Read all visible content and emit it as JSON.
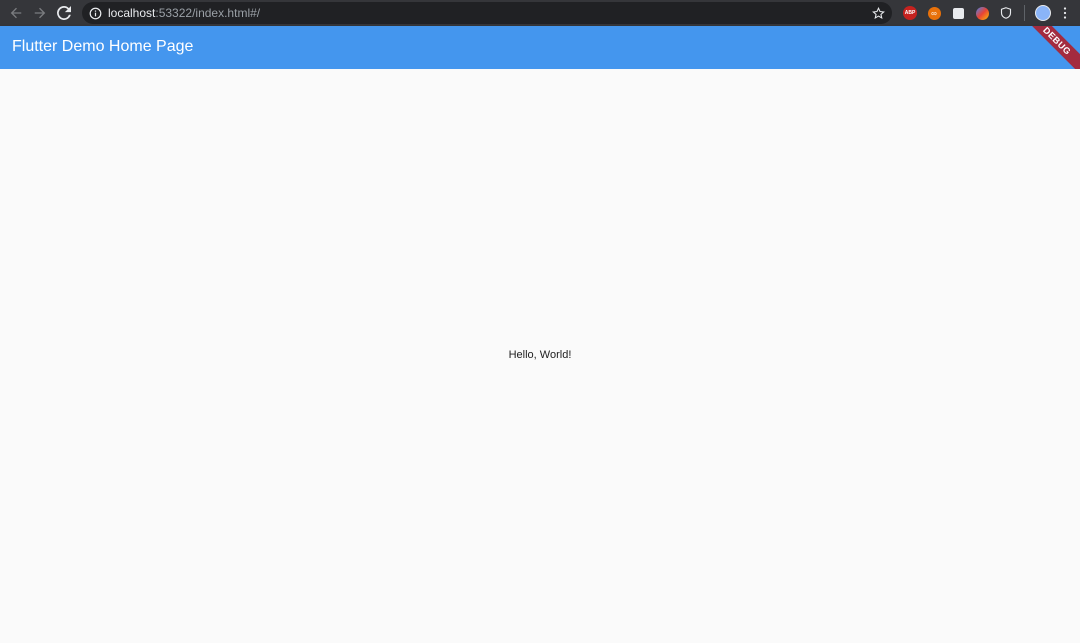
{
  "browser": {
    "url_host": "localhost",
    "url_rest": ":53322/index.html#/",
    "icons": {
      "back": "back-arrow-icon",
      "forward": "forward-arrow-icon",
      "reload": "reload-icon",
      "info": "info-icon",
      "star": "star-icon",
      "menu": "more-vert-icon"
    },
    "extensions": {
      "abp_label": "ABP"
    },
    "colors": {
      "toolbar": "#35363a",
      "omnibox": "#202124"
    }
  },
  "app_bar": {
    "title": "Flutter Demo Home Page",
    "color": "#4496ee"
  },
  "debug_banner": {
    "label": "DEBUG",
    "color": "#a32b3f"
  },
  "body": {
    "text": "Hello, World!"
  }
}
